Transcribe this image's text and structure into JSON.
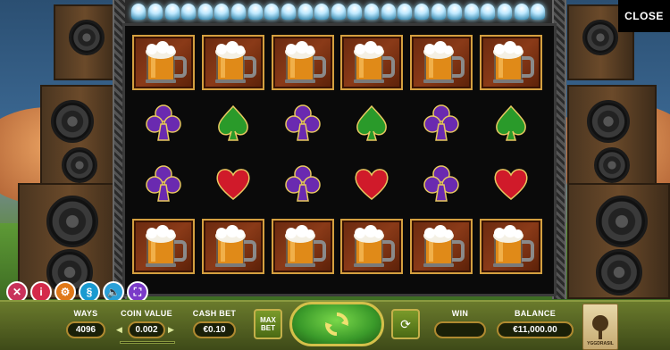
{
  "close_label": "CLOSE",
  "controls": [
    {
      "icon": "close-icon",
      "glyph": "✕",
      "color": "#c8325a"
    },
    {
      "icon": "info-icon",
      "glyph": "i",
      "color": "#d42a4a"
    },
    {
      "icon": "settings-gear-icon",
      "glyph": "⚙",
      "color": "#e07818"
    },
    {
      "icon": "rules-section-icon",
      "glyph": "§",
      "color": "#1a9ad0"
    },
    {
      "icon": "sound-icon",
      "glyph": "🔈",
      "color": "#2aa0d8"
    },
    {
      "icon": "fullscreen-icon",
      "glyph": "⛶",
      "color": "#7a3ac8"
    }
  ],
  "reels": {
    "columns": 6,
    "rows": [
      [
        "beer",
        "beer",
        "beer",
        "beer",
        "beer",
        "beer"
      ],
      [
        "club",
        "spade",
        "club",
        "spade",
        "club",
        "spade"
      ],
      [
        "club",
        "heart",
        "club",
        "heart",
        "club",
        "heart"
      ],
      [
        "beer",
        "beer",
        "beer",
        "beer",
        "beer",
        "beer"
      ]
    ]
  },
  "bottom": {
    "ways_label": "WAYS",
    "ways_value": "4096",
    "coin_value_label": "COIN VALUE",
    "coin_value": "0.002",
    "cash_bet_label": "CASH BET",
    "cash_bet_value": "€0.10",
    "max_bet_label": "MAX BET",
    "win_label": "WIN",
    "win_value": "",
    "balance_label": "BALANCE",
    "balance_value": "€11,000.00",
    "logo_text": "YGGDRASIL"
  },
  "colors": {
    "frame_gold": "#d4a040",
    "spin_green": "#3a9a2a",
    "club_purple": "#6a2ab0",
    "spade_green": "#2a9a2a",
    "heart_red": "#d01a2a"
  }
}
